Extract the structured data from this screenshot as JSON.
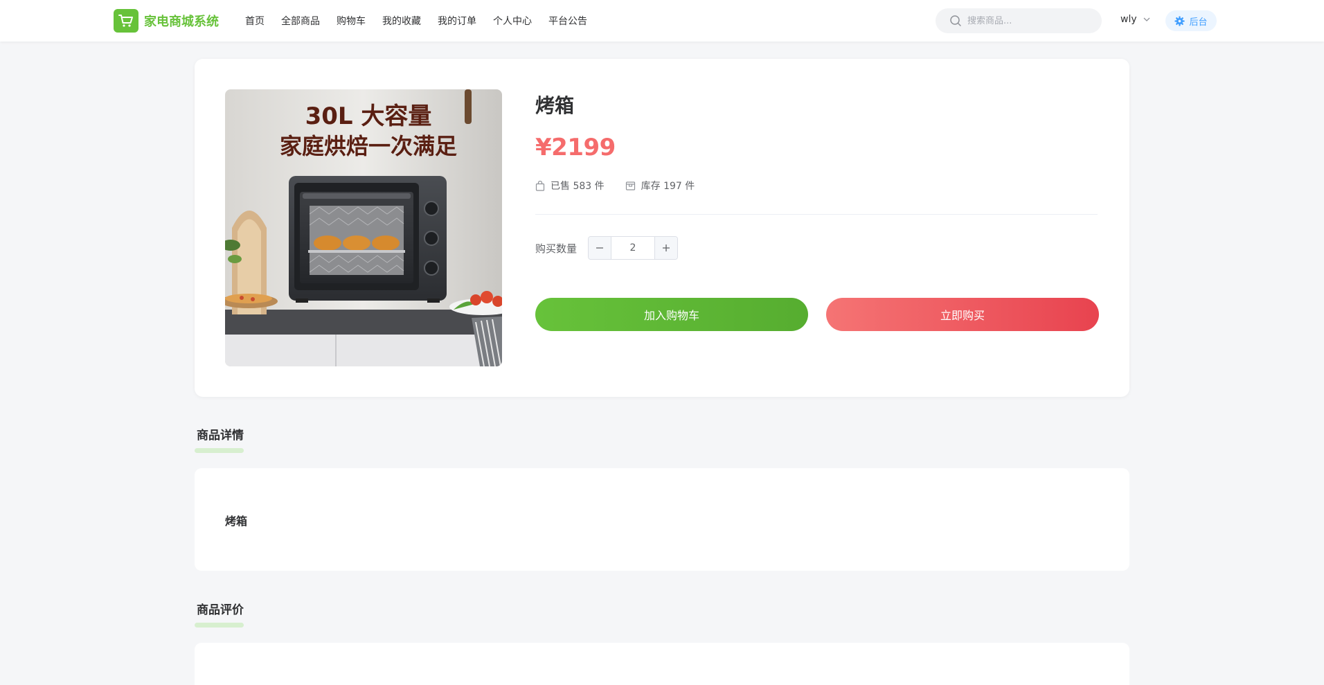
{
  "header": {
    "logo_text": "家电商城系统",
    "nav": [
      "首页",
      "全部商品",
      "购物车",
      "我的收藏",
      "我的订单",
      "个人中心",
      "平台公告"
    ],
    "search_placeholder": "搜索商品...",
    "username": "wly",
    "admin_label": "后台"
  },
  "product": {
    "title": "烤箱",
    "price": "¥2199",
    "sold": "已售 583 件",
    "stock": "库存 197 件",
    "quantity_label": "购买数量",
    "quantity": "2",
    "add_to_cart_label": "加入购物车",
    "buy_now_label": "立即购买",
    "image": {
      "headline_line1": "30L 大容量",
      "headline_line2": "家庭烘焙一次满足"
    }
  },
  "detail": {
    "title": "商品详情",
    "content": "烤箱"
  },
  "reviews": {
    "title": "商品评价"
  },
  "colors": {
    "brand_green": "#67c23a",
    "price_red": "#f56c6c",
    "admin_blue": "#409eff"
  }
}
